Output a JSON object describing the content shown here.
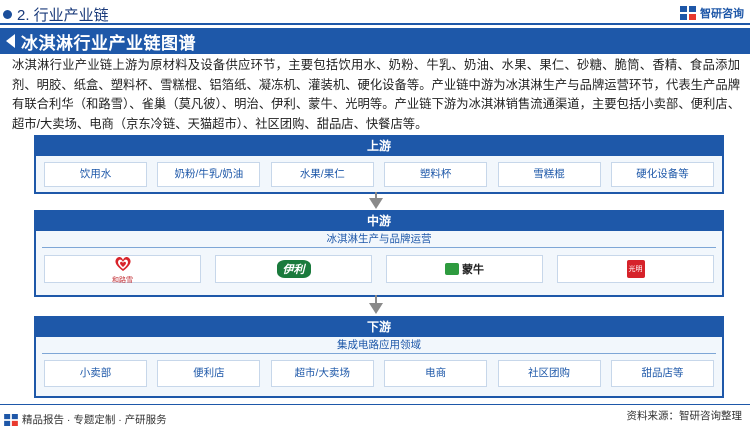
{
  "header": {
    "section_label": "2. 行业产业链",
    "brand": "智研咨询"
  },
  "title": "冰淇淋行业产业链图谱",
  "description": "冰淇淋行业产业链上游为原材料及设备供应环节，主要包括饮用水、奶粉、牛乳、奶油、水果、果仁、砂糖、脆筒、香精、食品添加剂、明胶、纸盒、塑料杯、雪糕棍、铝箔纸、凝冻机、灌装机、硬化设备等。产业链中游为冰淇淋生产与品牌运营环节，代表生产品牌有联合利华（和路雪）、雀巢（莫凡彼）、明治、伊利、蒙牛、光明等。产业链下游为冰淇淋销售流通渠道，主要包括小卖部、便利店、超市/大卖场、电商（京东冷链、天猫超市）、社区团购、甜品店、快餐店等。",
  "upstream": {
    "title": "上游",
    "items": [
      "饮用水",
      "奶粉/牛乳/奶油",
      "水果/果仁",
      "塑料杯",
      "雪糕棍",
      "硬化设备等"
    ]
  },
  "midstream": {
    "title": "中游",
    "subtitle": "冰淇淋生产与品牌运营",
    "brands": [
      {
        "name": "和路雪",
        "icon": "wall's-heart-logo"
      },
      {
        "name": "伊利",
        "icon": "yili-logo"
      },
      {
        "name": "蒙牛",
        "icon": "mengniu-logo"
      },
      {
        "name": "光明",
        "icon": "guangming-logo"
      }
    ]
  },
  "downstream": {
    "title": "下游",
    "subtitle": "集成电路应用领域",
    "items": [
      "小卖部",
      "便利店",
      "超市/大卖场",
      "电商",
      "社区团购",
      "甜品店等"
    ]
  },
  "footer": {
    "left": "精品报告 · 专题定制 · 产研服务",
    "right": "资料来源：智研咨询整理"
  },
  "colors": {
    "primary": "#1e58a9",
    "panel_bg": "#f2f7fc"
  }
}
